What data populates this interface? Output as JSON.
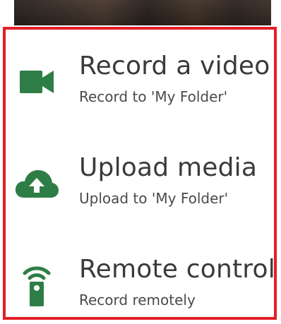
{
  "colors": {
    "accent_green": "#2f7d46",
    "selection_border": "#e41e26",
    "text_primary": "#3a3a3a",
    "text_secondary": "#4a4a4a"
  },
  "menu": {
    "items": [
      {
        "title": "Record a video",
        "subtitle": "Record to 'My Folder'",
        "icon": "video-camera-icon"
      },
      {
        "title": "Upload media",
        "subtitle": "Upload to 'My Folder'",
        "icon": "cloud-upload-icon"
      },
      {
        "title": "Remote control",
        "subtitle": "Record remotely",
        "icon": "remote-control-icon"
      }
    ]
  }
}
